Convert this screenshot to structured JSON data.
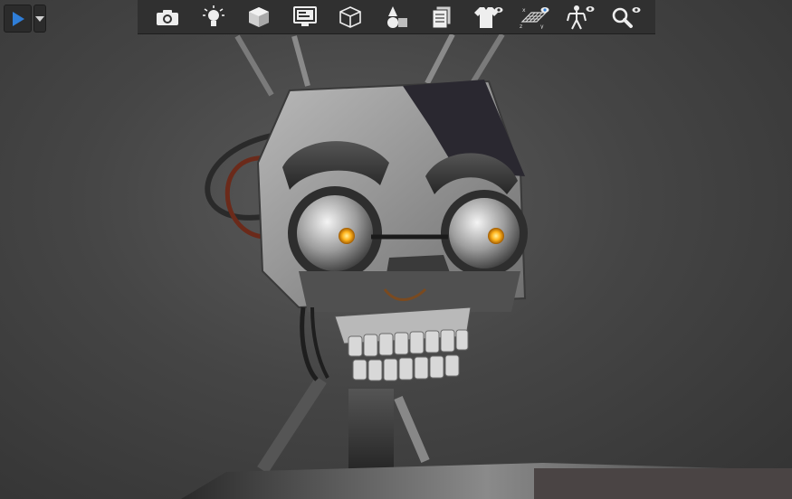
{
  "app": {
    "title": "",
    "accent": "#2f7ed8"
  },
  "controls": {
    "play": {
      "icon": "play-icon"
    },
    "dropdown": {
      "icon": "chevron-down-icon"
    }
  },
  "toolbar": {
    "tools": [
      {
        "icon": "camera-icon"
      },
      {
        "icon": "light-bulb-icon"
      },
      {
        "icon": "solid-cube-icon"
      },
      {
        "icon": "monitor-render-icon"
      },
      {
        "icon": "wireframe-cube-icon"
      },
      {
        "icon": "materials-icon"
      },
      {
        "icon": "texture-layers-icon"
      },
      {
        "icon": "shirt-visibility-icon"
      },
      {
        "icon": "grid-axes-visibility-icon"
      },
      {
        "icon": "skeleton-visibility-icon"
      },
      {
        "icon": "magnifier-visibility-icon"
      }
    ]
  },
  "scene": {
    "subject": "robot-head-model",
    "eye_glow": "#ffb41e",
    "metal": "#9a9a9a"
  }
}
